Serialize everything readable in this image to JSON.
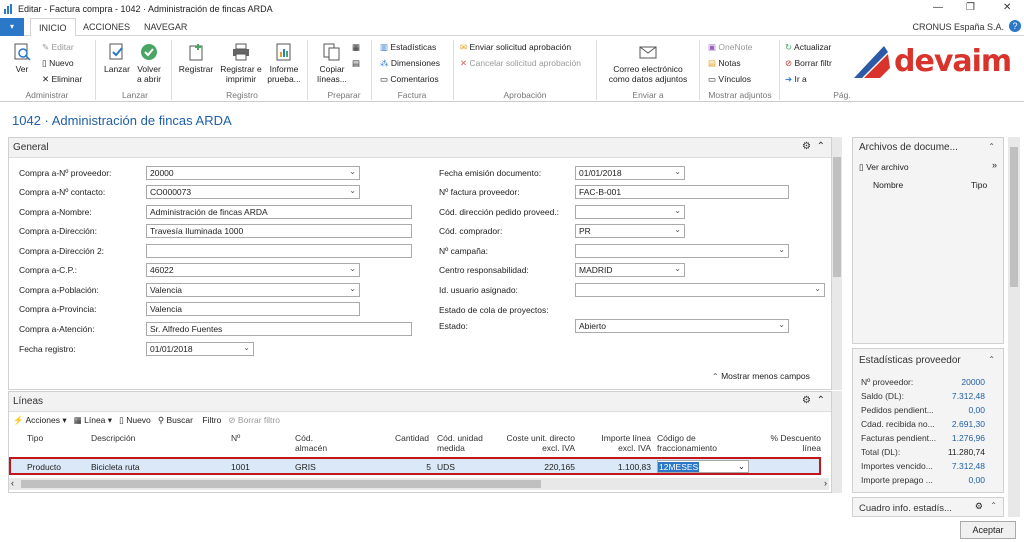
{
  "window": {
    "title": "Editar - Factura compra - 1042 · Administración de fincas ARDA"
  },
  "tabs": {
    "file": "▾",
    "inicio": "INICIO",
    "acciones": "ACCIONES",
    "navegar": "NAVEGAR"
  },
  "company": "CRONUS España S.A.",
  "ribbon": {
    "ver": "Ver",
    "editar": "Editar",
    "nuevo": "Nuevo",
    "eliminar": "Eliminar",
    "lanzar": "Lanzar",
    "volver_abrir": "Volver a abrir",
    "registrar": "Registrar",
    "registrar_imprimir": "Registrar e imprimir",
    "informe_prueba": "Informe prueba...",
    "copiar_lineas": "Copiar líneas...",
    "estadisticas": "Estadísticas",
    "dimensiones": "Dimensiones",
    "comentarios": "Comentarios",
    "enviar_solicitud": "Enviar solicitud aprobación",
    "cancelar_solicitud": "Cancelar solicitud aprobación",
    "correo": "Correo electrónico como datos adjuntos",
    "onenote": "OneNote",
    "notas": "Notas",
    "vinculos": "Vínculos",
    "actualizar": "Actualizar",
    "borrar_filtro": "Borrar filtr",
    "ir_a": "Ir a",
    "groups": {
      "administrar": "Administrar",
      "lanzar": "Lanzar",
      "registro": "Registro",
      "preparar": "Preparar",
      "factura": "Factura",
      "aprobacion": "Aprobación",
      "enviar_a": "Enviar a",
      "mostrar_adjuntos": "Mostrar adjuntos",
      "pag": "Pág."
    },
    "logo": "devaim"
  },
  "page_title": "1042 · Administración de fincas ARDA",
  "general": {
    "header": "General",
    "left": [
      {
        "label": "Compra a-Nº proveedor:",
        "value": "20000"
      },
      {
        "label": "Compra a-Nº contacto:",
        "value": "CO000073"
      },
      {
        "label": "Compra a-Nombre:",
        "value": "Administración de fincas ARDA"
      },
      {
        "label": "Compra a-Dirección:",
        "value": "Travesía Iluminada 1000"
      },
      {
        "label": "Compra a-Dirección 2:",
        "value": ""
      },
      {
        "label": "Compra a-C.P.:",
        "value": "46022"
      },
      {
        "label": "Compra a-Población:",
        "value": "Valencia"
      },
      {
        "label": "Compra a-Provincia:",
        "value": "Valencia"
      },
      {
        "label": "Compra a-Atención:",
        "value": "Sr. Alfredo Fuentes"
      },
      {
        "label": "Fecha registro:",
        "value": "01/01/2018"
      }
    ],
    "right": [
      {
        "label": "Fecha emisión documento:",
        "value": "01/01/2018"
      },
      {
        "label": "Nº factura proveedor:",
        "value": "FAC-B-001"
      },
      {
        "label": "Cód. dirección pedido proveed.:",
        "value": ""
      },
      {
        "label": "Cód. comprador:",
        "value": "PR"
      },
      {
        "label": "Nº campaña:",
        "value": ""
      },
      {
        "label": "Centro responsabilidad:",
        "value": "MADRID"
      },
      {
        "label": "Id. usuario asignado:",
        "value": ""
      },
      {
        "label": "Estado de cola de proyectos:",
        "value": ""
      },
      {
        "label": "Estado:",
        "value": "Abierto"
      }
    ],
    "show_less": "Mostrar menos campos"
  },
  "lineas": {
    "header": "Líneas",
    "toolbar": {
      "acciones": "Acciones",
      "linea": "Línea",
      "nuevo": "Nuevo",
      "buscar": "Buscar",
      "filtro": "Filtro",
      "borrar_filtro": "Borrar filtro"
    },
    "columns": [
      "Tipo",
      "Descripción",
      "Nº",
      "Cód. almacén",
      "Cantidad",
      "Cód. unidad medida",
      "Coste unit. directo excl. IVA",
      "Importe línea excl. IVA",
      "Código de fraccionamiento",
      "% Descuento línea"
    ],
    "rows": [
      {
        "tipo": "Producto",
        "descripcion": "Bicicleta ruta",
        "no": "1001",
        "almacen": "GRIS",
        "cantidad": "5",
        "unidad": "UDS",
        "coste": "220,165",
        "importe": "1.100,83",
        "fracc": "12MESES",
        "descuento": ""
      }
    ]
  },
  "factbox_docs": {
    "header": "Archivos de docume...",
    "ver": "Ver archivo",
    "col_nombre": "Nombre",
    "col_tipo": "Tipo"
  },
  "factbox_stats": {
    "header": "Estadísticas proveedor",
    "rows": [
      {
        "label": "Nº proveedor:",
        "value": "20000"
      },
      {
        "label": "Saldo (DL):",
        "value": "7.312,48"
      },
      {
        "label": "Pedidos pendient...",
        "value": "0,00"
      },
      {
        "label": "Cdad. recibida no...",
        "value": "2.691,30"
      },
      {
        "label": "Facturas pendient...",
        "value": "1.276,96"
      },
      {
        "label": "Total (DL):",
        "value": "11.280,74"
      },
      {
        "label": "Importes vencido...",
        "value": "7.312,48"
      },
      {
        "label": "Importe prepago ...",
        "value": "0,00"
      }
    ]
  },
  "factbox_cuadro": {
    "header": "Cuadro info. estadís..."
  },
  "accept": "Aceptar"
}
